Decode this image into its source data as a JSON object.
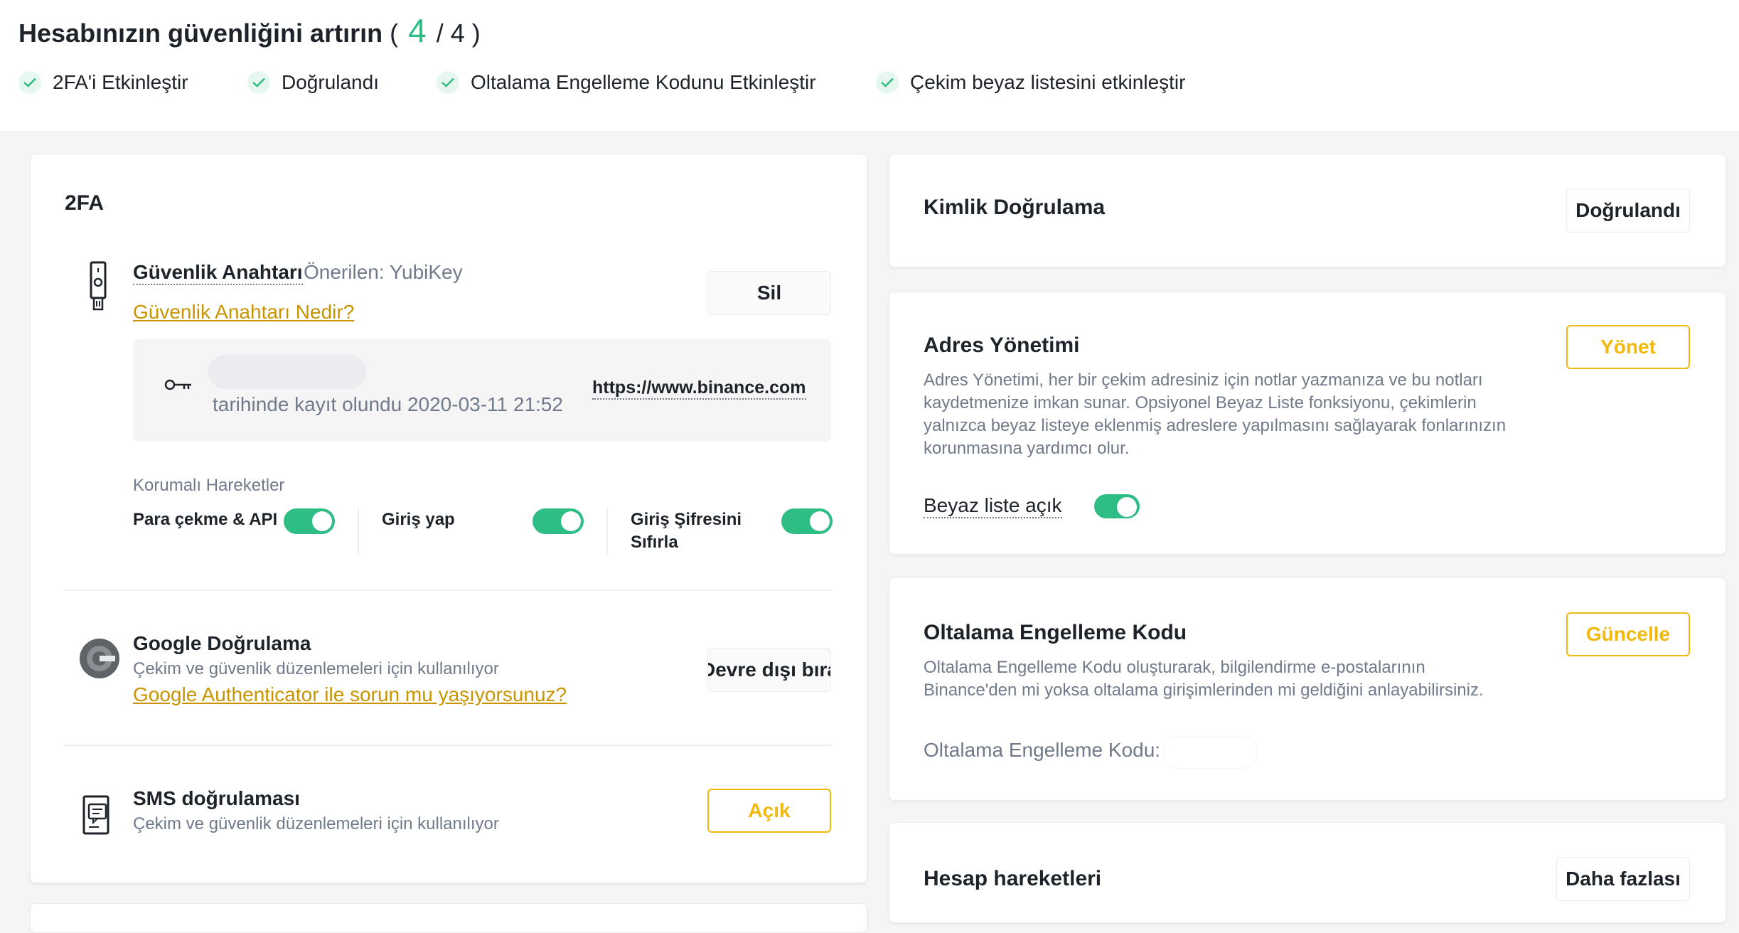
{
  "header": {
    "title_text": "Hesabınızın güvenliğini artırın",
    "progress_open": "(",
    "progress_done": "4",
    "progress_total": "/ 4 )",
    "accent_color": "#2ebd85",
    "steps": [
      {
        "label": "2FA'i Etkinleştir",
        "icon": "check-icon"
      },
      {
        "label": "Doğrulandı",
        "icon": "check-icon"
      },
      {
        "label": "Oltalama Engelleme Kodunu Etkinleştir",
        "icon": "check-icon"
      },
      {
        "label": "Çekim beyaz listesini etkinleştir",
        "icon": "check-icon"
      }
    ]
  },
  "twofa": {
    "title": "2FA",
    "security_key": {
      "icon": "usb-key-icon",
      "title": "Güvenlik Anahtarı",
      "recommended": "Önerilen: YubiKey",
      "help_link": "Güvenlik Anahtarı Nedir?",
      "delete_button": "Sil",
      "key_icon": "key-icon",
      "registered_text": "tarihinde kayıt olundu 2020-03-11 21:52",
      "site": "https://www.binance.com"
    },
    "protected_actions": {
      "label": "Korumalı Hareketler",
      "items": [
        {
          "label": "Para çekme & API",
          "enabled": true
        },
        {
          "label": "Giriş yap",
          "enabled": true
        },
        {
          "label_line1": "Giriş Şifresini",
          "label_line2": "Sıfırla",
          "enabled": true
        }
      ]
    },
    "google": {
      "icon": "google-authenticator-icon",
      "title": "Google Doğrulama",
      "desc": "Çekim ve güvenlik düzenlemeleri için kullanılıyor",
      "help_link": "Google Authenticator ile sorun mu yaşıyorsunuz?",
      "button": "Devre dışı bırak"
    },
    "sms": {
      "icon": "sms-icon",
      "title": "SMS doğrulaması",
      "desc": "Çekim ve güvenlik düzenlemeleri için kullanılıyor",
      "button": "Açık"
    }
  },
  "identity": {
    "title": "Kimlik Doğrulama",
    "button": "Doğrulandı"
  },
  "address": {
    "title": "Adres Yönetimi",
    "button": "Yönet",
    "desc_lines": [
      "Adres Yönetimi, her bir çekim adresiniz için notlar yazmanıza ve bu notları",
      "kaydetmenize imkan sunar. Opsiyonel Beyaz Liste fonksiyonu, çekimlerin",
      "yalnızca beyaz listeye eklenmiş adreslere yapılmasını sağlayarak fonlarınızın",
      "korunmasına yardımcı olur."
    ],
    "whitelist_label": "Beyaz liste açık",
    "whitelist_enabled": true
  },
  "antiphishing": {
    "title": "Oltalama Engelleme Kodu",
    "button": "Güncelle",
    "desc_lines": [
      "Oltalama Engelleme Kodu oluşturarak, bilgilendirme e-postalarının",
      "Binance'den mi yoksa oltalama girişimlerinden mi geldiğini anlayabilirsiniz."
    ],
    "code_label": "Oltalama Engelleme Kodu:"
  },
  "activity": {
    "title": "Hesap hareketleri",
    "button": "Daha fazlası"
  }
}
